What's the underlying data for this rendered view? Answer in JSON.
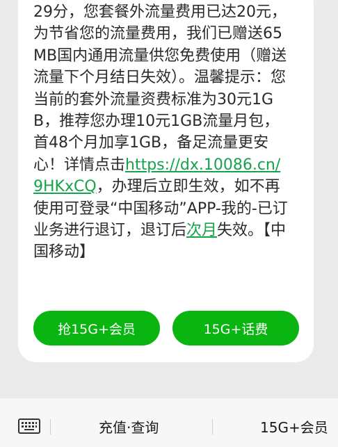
{
  "message": {
    "part1": "29分，您套餐外流量费用已达20元，为节省您的流量费用，我们已赠送65MB国内通用流量供您免费使用（赠送流量下个月结日失效）。温馨提示：您当前的套外流量资费标准为30元1GB，推荐您办理10元1GB流量月包，首48个月加享1GB，备足流量更安心！详情点击",
    "link": "https://dx.10086.cn/9HKxCQ",
    "part2": "，办理后立即生效，如不再使用可登录“中国移动”APP-我的-已订业务进行退订，退订后",
    "link2": "次月",
    "part3": "失效。【中国移动】"
  },
  "buttons": {
    "left": "抢15G+会员",
    "right": "15G+话费"
  },
  "bottom_menu": {
    "item1": "充值·查询",
    "item2": "15G+会员"
  },
  "colors": {
    "accent": "#0bb511",
    "link": "#16a34a"
  }
}
